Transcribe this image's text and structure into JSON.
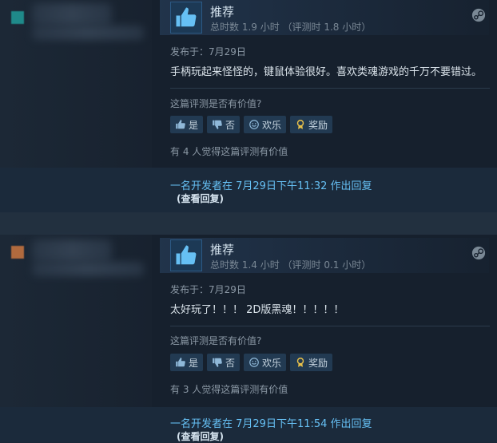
{
  "reviews": [
    {
      "title": "推荐",
      "playtime": "总时数 1.9 小时 （评测时 1.8 小时）",
      "posted": "发布于：7月29日",
      "content": "手柄玩起来怪怪的，键鼠体验很好。喜欢类魂游戏的千万不要错过。",
      "helpful_question": "这篇评测是否有价值?",
      "buttons": {
        "yes": "是",
        "no": "否",
        "funny": "欢乐",
        "award": "奖励"
      },
      "found_helpful": "有 4 人觉得这篇评测有价值",
      "dev_response": "一名开发者在 7月29日下午11:32 作出回复",
      "view_reply": "(查看回复)",
      "avatar_color": "#1f8a8a"
    },
    {
      "title": "推荐",
      "playtime": "总时数 1.4 小时 （评测时 0.1 小时）",
      "posted": "发布于：7月29日",
      "content": "太好玩了！！！ 2D版黑魂！！！！！",
      "helpful_question": "这篇评测是否有价值?",
      "buttons": {
        "yes": "是",
        "no": "否",
        "funny": "欢乐",
        "award": "奖励"
      },
      "found_helpful": "有 3 人觉得这篇评测有价值",
      "dev_response": "一名开发者在 7月29日下午11:54 作出回复",
      "view_reply": "(查看回复)",
      "avatar_color": "#b06a3e"
    }
  ],
  "colors": {
    "link": "#66c0f4",
    "background": "#1b2838",
    "thumb_up": "#66c0f4",
    "award": "#e8c14a"
  }
}
